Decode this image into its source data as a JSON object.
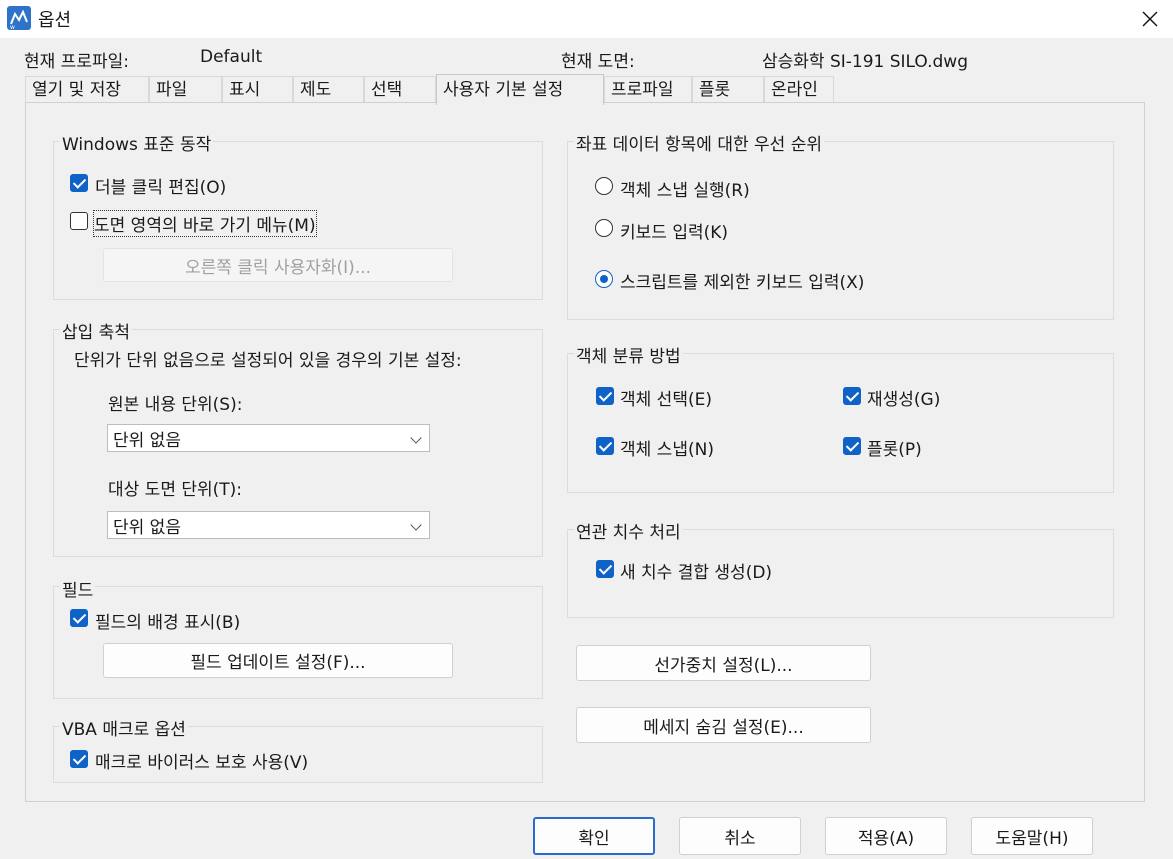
{
  "window": {
    "title": "옵션",
    "close_symbol": "✕"
  },
  "header": {
    "profile_label": "현재 프로파일:",
    "profile_value": "Default",
    "drawing_label": "현재 도면:",
    "drawing_value": "삼승화학 SI-191 SILO.dwg"
  },
  "tabs": [
    {
      "label": "열기 및 저장"
    },
    {
      "label": "파일"
    },
    {
      "label": "표시"
    },
    {
      "label": "제도"
    },
    {
      "label": "선택"
    },
    {
      "label": "사용자 기본 설정",
      "active": true
    },
    {
      "label": "프로파일"
    },
    {
      "label": "플롯"
    },
    {
      "label": "온라인"
    }
  ],
  "windows_standard": {
    "title": "Windows 표준 동작",
    "double_click_edit": {
      "label": "더블 클릭 편집(O)",
      "checked": true
    },
    "shortcut_menu": {
      "label": "도면 영역의 바로 가기 메뉴(M)",
      "checked": false
    },
    "right_click_button": "오른쪽 클릭 사용자화(I)..."
  },
  "insert_scale": {
    "title": "삽입 축척",
    "description": "단위가 단위 없음으로 설정되어 있을 경우의 기본 설정:",
    "source_label": "원본 내용 단위(S):",
    "source_value": "단위 없음",
    "target_label": "대상 도면 단위(T):",
    "target_value": "단위 없음"
  },
  "field": {
    "title": "필드",
    "show_background": {
      "label": "필드의 배경 표시(B)",
      "checked": true
    },
    "update_button": "필드 업데이트 설정(F)..."
  },
  "vba": {
    "title": "VBA 매크로 옵션",
    "virus_protection": {
      "label": "매크로 바이러스 보호 사용(V)",
      "checked": true
    }
  },
  "coordinate_priority": {
    "title": "좌표 데이터 항목에 대한 우선 순위",
    "options": [
      {
        "label": "객체 스냅 실행(R)",
        "selected": false
      },
      {
        "label": "키보드 입력(K)",
        "selected": false
      },
      {
        "label": "스크립트를 제외한 키보드 입력(X)",
        "selected": true
      }
    ]
  },
  "object_sorting": {
    "title": "객체 분류 방법",
    "object_selection": {
      "label": "객체 선택(E)",
      "checked": true
    },
    "regen": {
      "label": "재생성(G)",
      "checked": true
    },
    "object_snap": {
      "label": "객체 스냅(N)",
      "checked": true
    },
    "plot": {
      "label": "플롯(P)",
      "checked": true
    }
  },
  "associative_dim": {
    "title": "연관 치수 처리",
    "new_dims": {
      "label": "새 치수 결합 생성(D)",
      "checked": true
    }
  },
  "lineweight_button": "선가중치 설정(L)...",
  "hidden_messages_button": "메세지 숨김 설정(E)...",
  "footer": {
    "ok": "확인",
    "cancel": "취소",
    "apply": "적용(A)",
    "help": "도움말(H)"
  },
  "colors": {
    "accent": "#0f62c6",
    "default_button_border": "#2a6bd0"
  }
}
